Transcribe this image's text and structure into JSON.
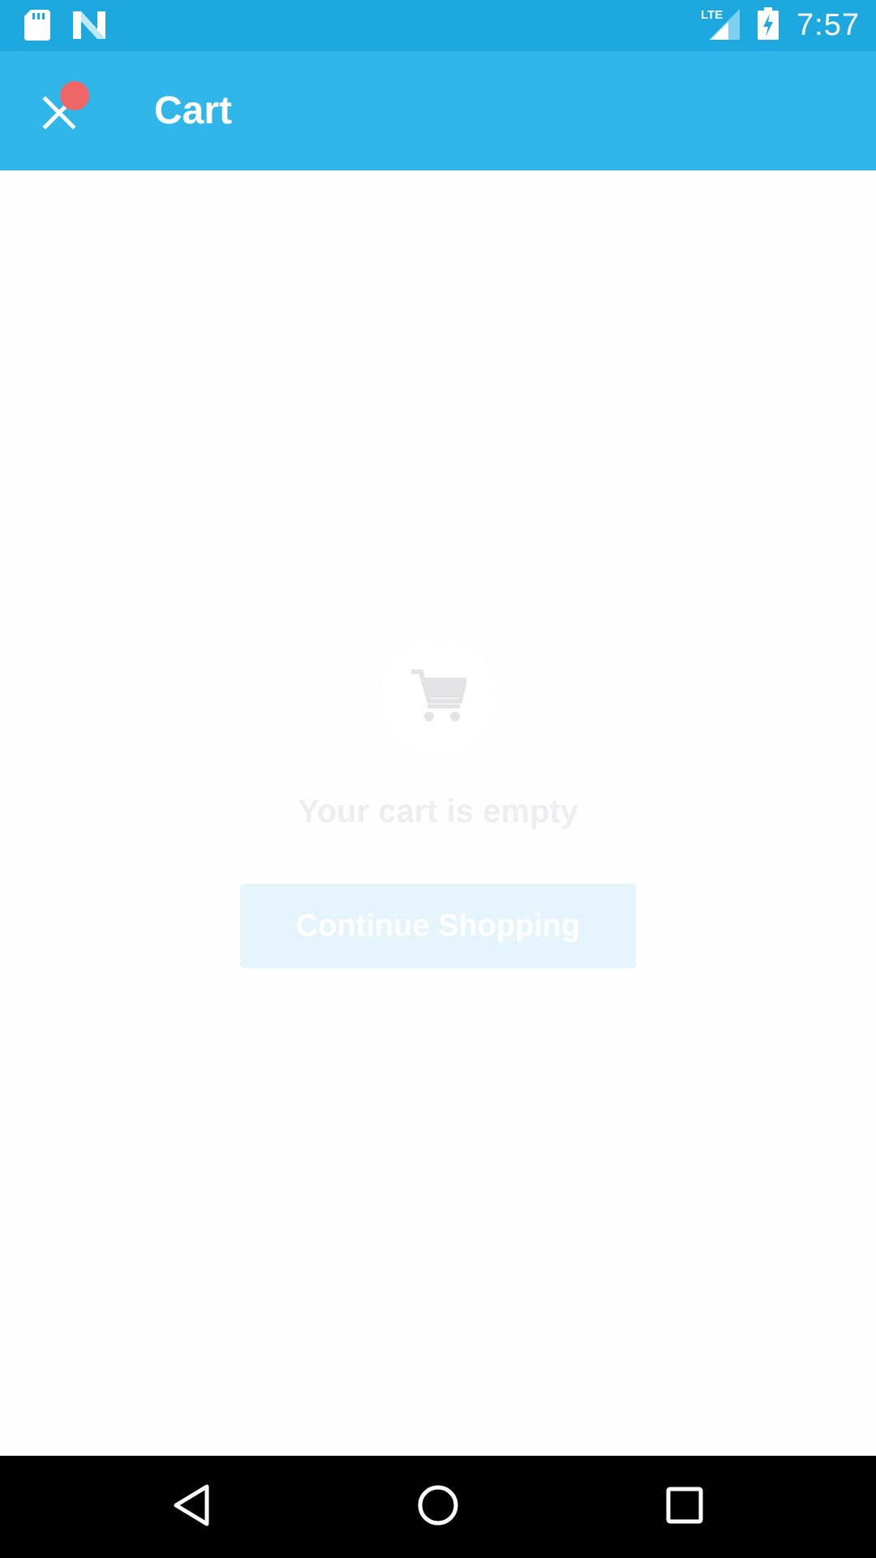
{
  "status_bar": {
    "time": "7:57",
    "network": "LTE",
    "icons": [
      "sd-card-icon",
      "app-n-icon",
      "lte-signal-icon",
      "battery-charging-icon"
    ]
  },
  "app_bar": {
    "title": "Cart",
    "close_icon": "close-icon",
    "color": "#30b6e9"
  },
  "empty_state": {
    "icon": "cart-icon",
    "message": "Your cart is empty",
    "button_label": "Continue Shopping"
  },
  "nav_bar": {
    "icons": [
      "back-icon",
      "home-icon",
      "recents-icon"
    ]
  },
  "colors": {
    "status_bar": "#1da9e0",
    "app_bar": "#30b6e9",
    "record_dot": "#f06567",
    "button_bg": "#e6f5fc",
    "empty_text": "#eeeef0"
  }
}
